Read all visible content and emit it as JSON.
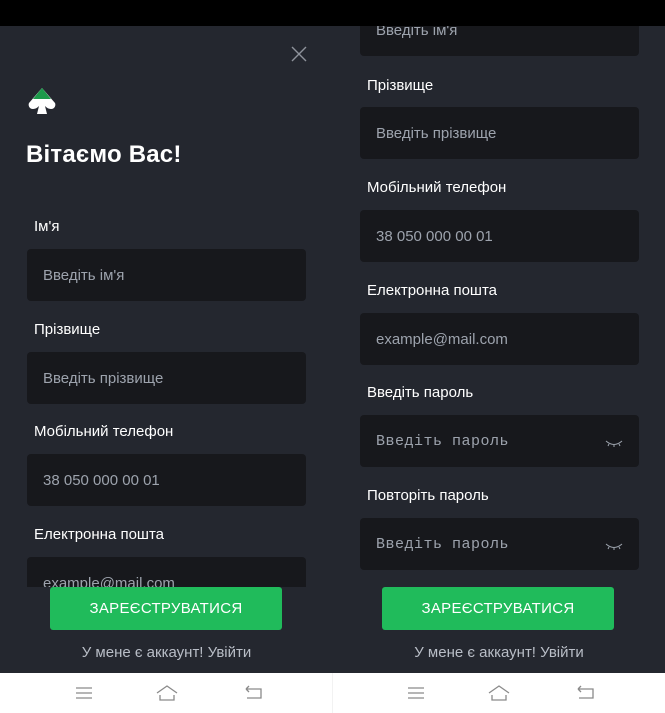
{
  "login_left": {
    "title": "Вітаємо Вас!",
    "fields": [
      {
        "label": "Ім'я",
        "placeholder": "Введіть ім'я"
      },
      {
        "label": "Прізвище",
        "placeholder": "Введіть прізвище"
      },
      {
        "label": "Мобільний телефон",
        "placeholder": "38 050 000 00 01"
      },
      {
        "label": "Електронна пошта",
        "placeholder": "example@mail.com"
      }
    ],
    "register_button": "ЗАРЕЄСТРУВАТИСЯ",
    "login_link": "У мене є аккаунт! Увійти"
  },
  "login_right": {
    "top_field_placeholder": "Введіть ім'я",
    "fields": [
      {
        "label": "Прізвище",
        "placeholder": "Введіть прізвище"
      },
      {
        "label": "Мобільний телефон",
        "placeholder": "38 050 000 00 01"
      },
      {
        "label": "Електронна пошта",
        "placeholder": "example@mail.com"
      },
      {
        "label": "Введіть пароль",
        "placeholder": "Введіть пароль"
      },
      {
        "label": "Повторіть пароль",
        "placeholder": "Введіть пароль"
      }
    ],
    "register_button": "ЗАРЕЄСТРУВАТИСЯ",
    "login_link": "У мене є аккаунт! Увійти"
  },
  "icons": {
    "close": "close-icon",
    "logo": "spade-logo-icon",
    "password_toggle": "eye-closed-icon",
    "nav_menu": "menu-icon",
    "nav_home": "home-icon",
    "nav_back": "back-icon"
  },
  "colors": {
    "background": "#24272f",
    "field": "#17181c",
    "accent": "#20bb5b",
    "logo_green": "#1c9a4a"
  }
}
